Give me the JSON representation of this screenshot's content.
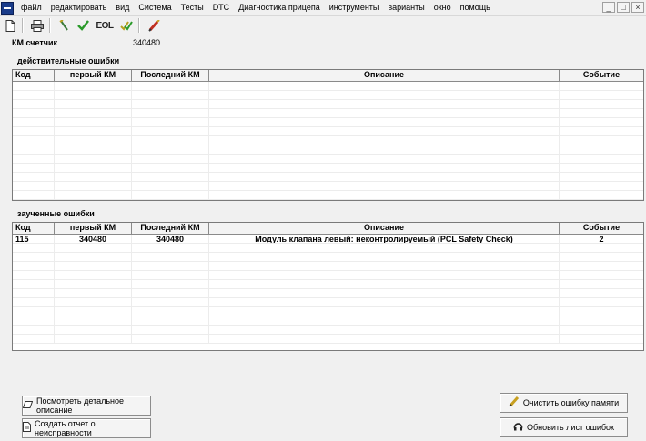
{
  "menu": [
    "файл",
    "редактировать",
    "вид",
    "Система",
    "Тесты",
    "DTC",
    "Диагностика прицепа",
    "инструменты",
    "варианты",
    "окно",
    "помощь"
  ],
  "window_controls": [
    "_",
    "□",
    "×"
  ],
  "toolbar": {
    "eol_label": "EOL"
  },
  "km": {
    "label": "КМ счетчик",
    "value": "340480"
  },
  "active_faults": {
    "title": "действительные ошибки",
    "columns": [
      "Код",
      "первый КМ",
      "Последний КМ",
      "Описание",
      "Событие"
    ],
    "rows": []
  },
  "stored_faults": {
    "title": "заученные ошибки",
    "columns": [
      "Код",
      "первый КМ",
      "Последний КМ",
      "Описание",
      "Событие"
    ],
    "rows": [
      [
        "115",
        "340480",
        "340480",
        "Модуль клапана левый: неконтролируемый (PCL Safety Check)",
        "2"
      ]
    ]
  },
  "buttons": {
    "view_details": "Посмотреть детальное описание",
    "create_report": "Создать отчет о неисправности",
    "clear_memory": "Очистить ошибку памяти",
    "refresh_list": "Обновить лист ошибок"
  }
}
